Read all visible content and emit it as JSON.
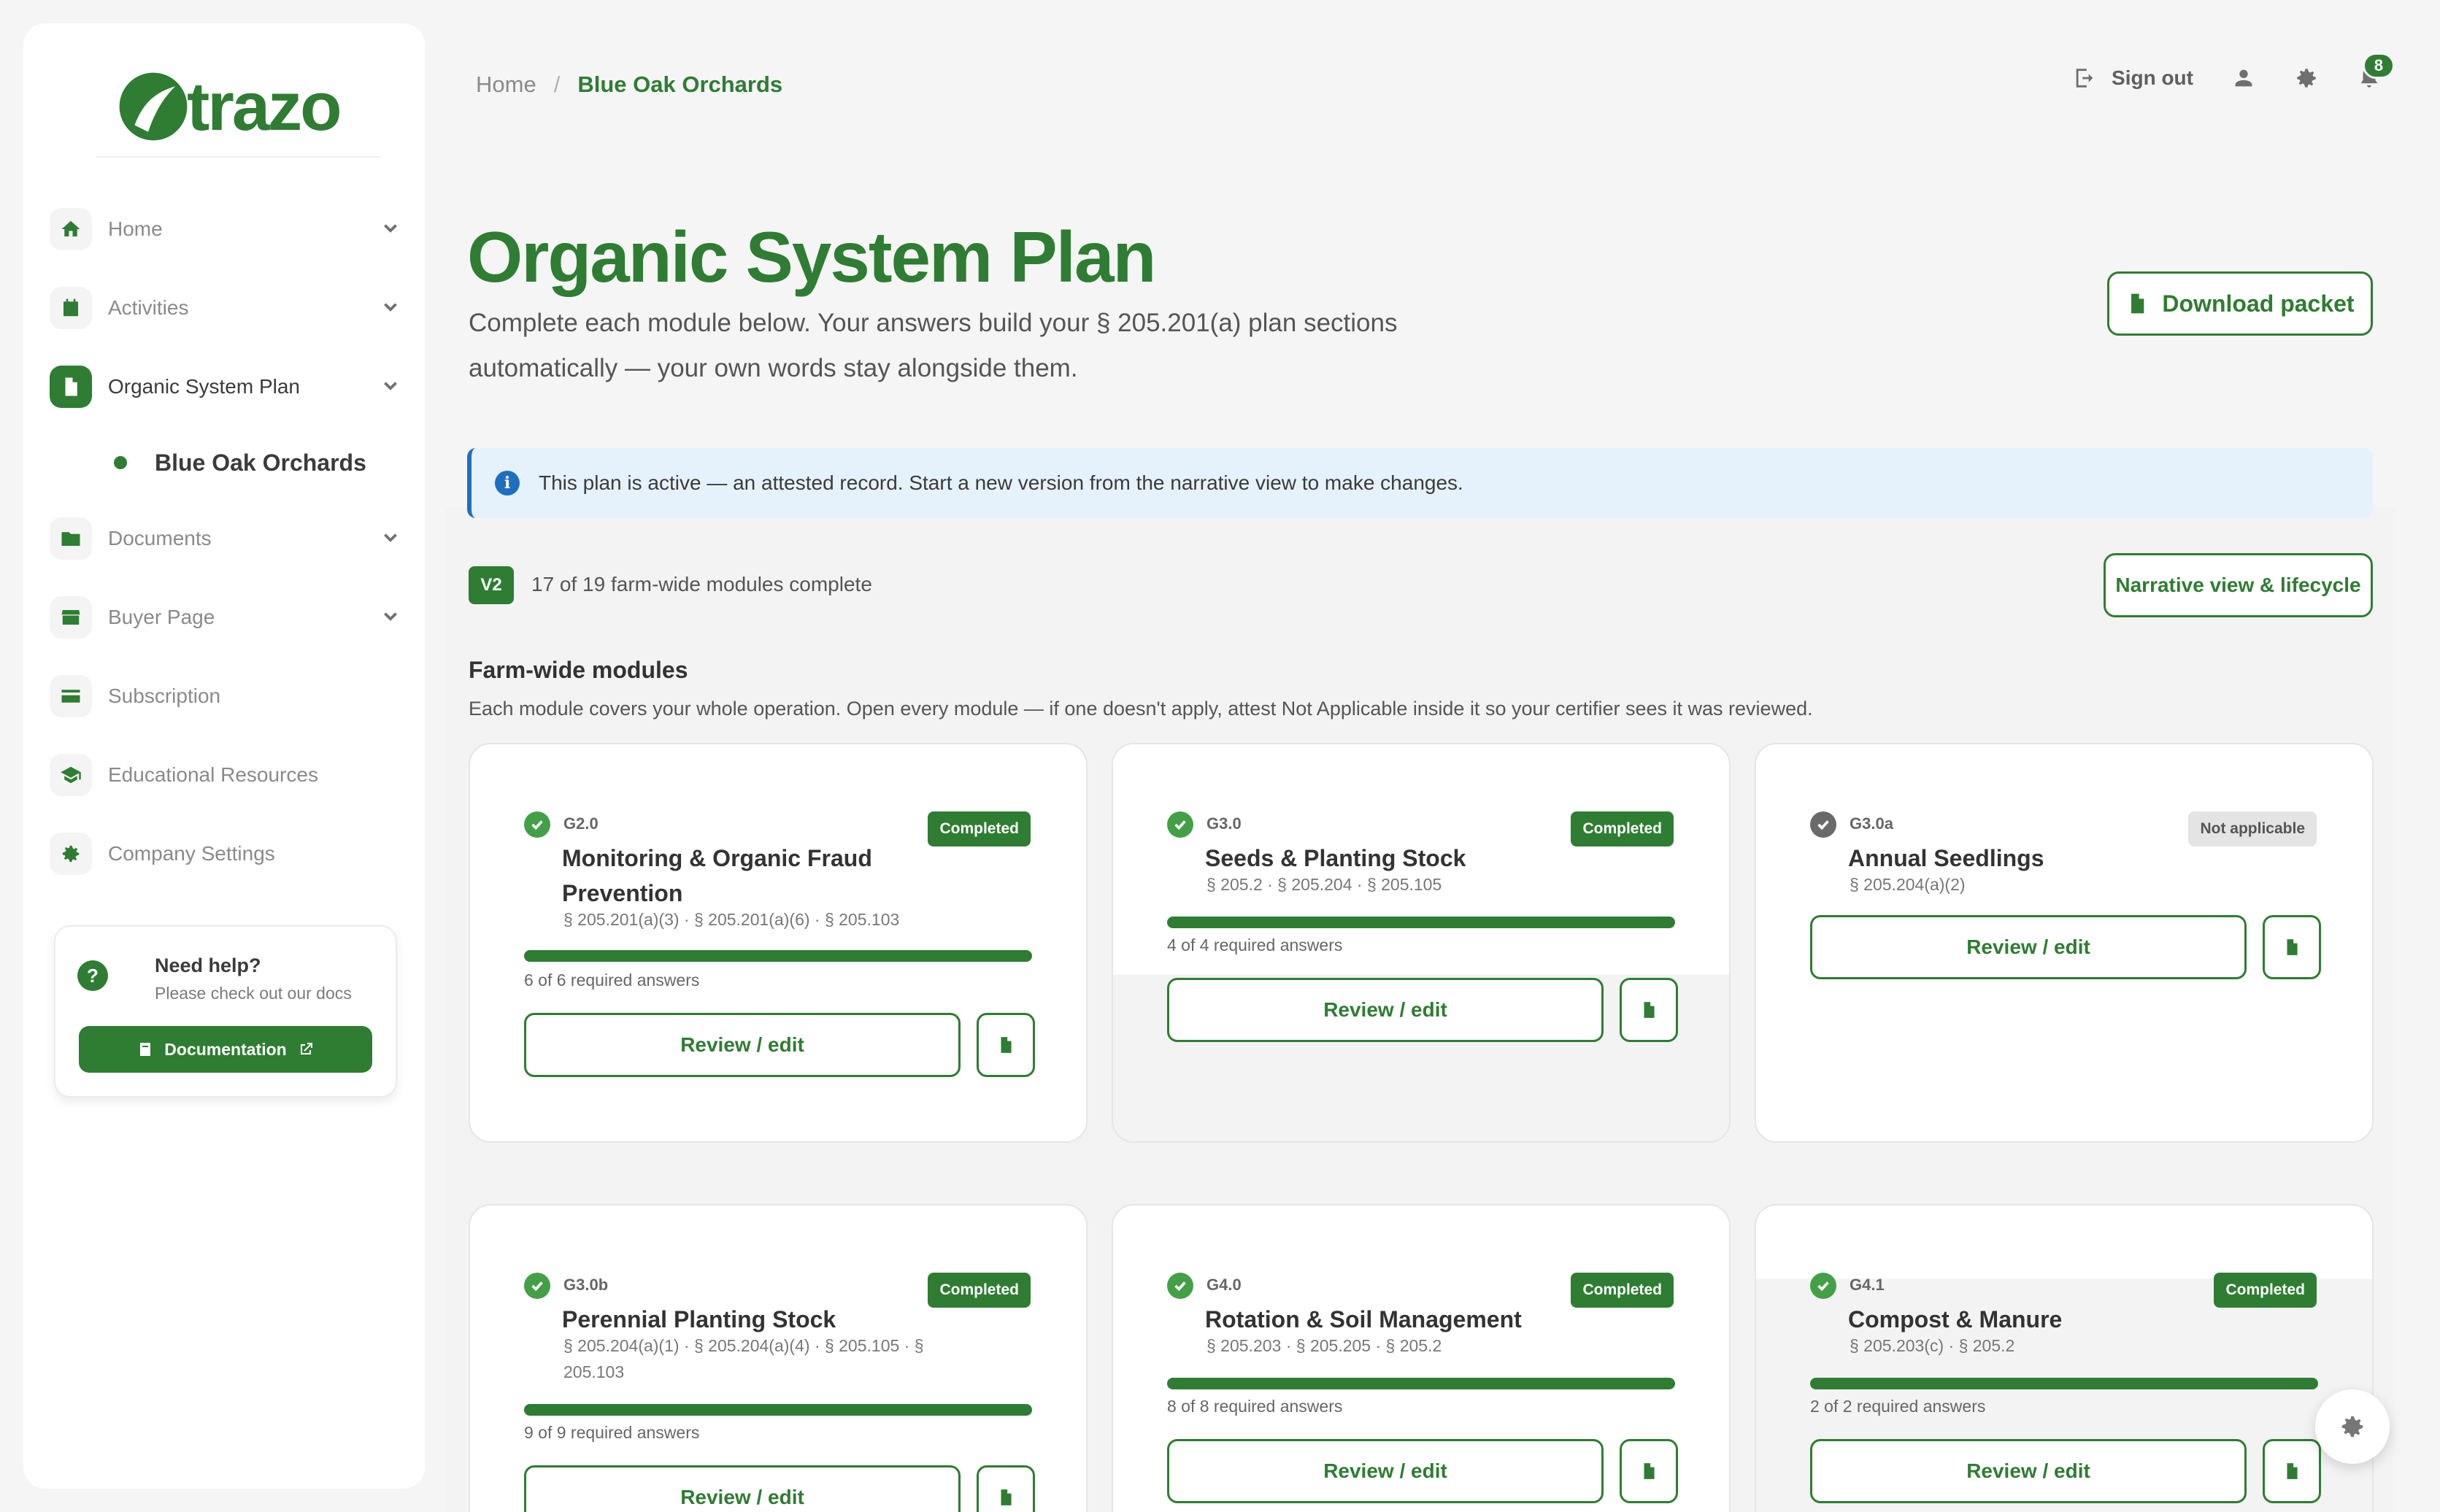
{
  "brand": {
    "name": "trazo",
    "color": "#2e7d32"
  },
  "sidebar": {
    "items": [
      {
        "label": "Home",
        "icon": "home-icon"
      },
      {
        "label": "Activities",
        "icon": "calendar-icon"
      },
      {
        "label": "Organic System Plan",
        "icon": "document-icon",
        "active": true
      },
      {
        "label": "Documents",
        "icon": "folder-icon"
      },
      {
        "label": "Buyer Page",
        "icon": "store-icon"
      },
      {
        "label": "Subscription",
        "icon": "credit-card-icon"
      },
      {
        "label": "Educational Resources",
        "icon": "graduation-cap-icon"
      },
      {
        "label": "Company Settings",
        "icon": "gear-icon"
      }
    ],
    "sub_item": {
      "label": "Blue Oak Orchards"
    },
    "help": {
      "title": "Need help?",
      "subtitle": "Please check out our docs",
      "button": "Documentation"
    }
  },
  "breadcrumb": {
    "home": "Home",
    "separator": "/",
    "current": "Blue Oak Orchards"
  },
  "topbar": {
    "sign_out": "Sign out",
    "notifications": "8"
  },
  "header": {
    "title": "Organic System Plan",
    "subtitle": "Complete each module below. Your answers build your § 205.201(a) plan sections automatically — your own words stay alongside them.",
    "download": "Download packet"
  },
  "info": {
    "text": "This plan is active — an attested record. Start a new version from the narrative view to make changes."
  },
  "version": {
    "badge": "V2",
    "text": "17 of 19 farm-wide modules complete",
    "narrative_button": "Narrative view & lifecycle"
  },
  "section": {
    "title": "Farm-wide modules",
    "subtitle": "Each module covers your whole operation. Open every module — if one doesn't apply, attest Not Applicable inside it so your certifier sees it was reviewed."
  },
  "review_label": "Review / edit",
  "modules": [
    {
      "code": "G2.0",
      "title": "Monitoring & Organic Fraud Prevention",
      "cfr": "§ 205.201(a)(3) · § 205.201(a)(6) · § 205.103",
      "status": "Completed",
      "answers": "6 of 6 required answers",
      "progress": 1.0
    },
    {
      "code": "G3.0",
      "title": "Seeds & Planting Stock",
      "cfr": "§ 205.2 · § 205.204 · § 205.105",
      "status": "Completed",
      "answers": "4 of 4 required answers",
      "progress": 1.0
    },
    {
      "code": "G3.0a",
      "title": "Annual Seedlings",
      "cfr": "§ 205.204(a)(2)",
      "status": "Not applicable",
      "answers": "",
      "progress": 0
    },
    {
      "code": "G3.0b",
      "title": "Perennial Planting Stock",
      "cfr": "§ 205.204(a)(1) · § 205.204(a)(4) · § 205.105 · § 205.103",
      "status": "Completed",
      "answers": "9 of 9 required answers",
      "progress": 1.0
    },
    {
      "code": "G4.0",
      "title": "Rotation & Soil Management",
      "cfr": "§ 205.203 · § 205.205 · § 205.2",
      "status": "Completed",
      "answers": "8 of 8 required answers",
      "progress": 1.0
    },
    {
      "code": "G4.1",
      "title": "Compost & Manure",
      "cfr": "§ 205.203(c) · § 205.2",
      "status": "Completed",
      "answers": "2 of 2 required answers",
      "progress": 1.0
    }
  ]
}
